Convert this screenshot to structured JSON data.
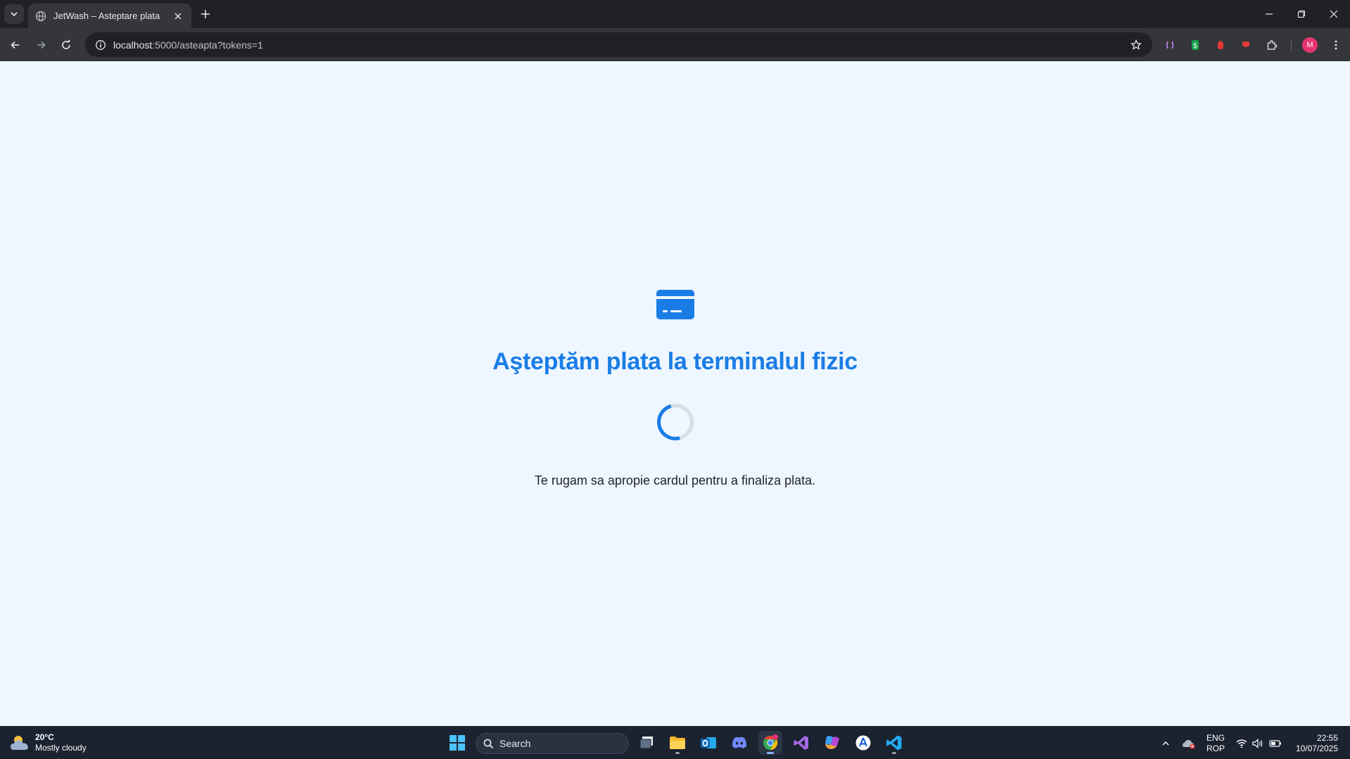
{
  "browser": {
    "tab_title": "JetWash – Asteptare plata",
    "url_host": "localhost",
    "url_rest": ":5000/asteapta?tokens=1",
    "profile_initial": "M"
  },
  "page": {
    "icon": "credit-card-icon",
    "heading": "Aşteptăm plata la terminalul fizic",
    "message": "Te rugam sa apropie cardul pentru a finaliza plata.",
    "accent_color": "#1a7de6",
    "background_color": "#eef6ff"
  },
  "taskbar": {
    "weather_temp": "20°C",
    "weather_desc": "Mostly cloudy",
    "search_label": "Search",
    "lang_line1": "ENG",
    "lang_line2": "ROP",
    "time": "22:55",
    "date": "10/07/2025"
  }
}
